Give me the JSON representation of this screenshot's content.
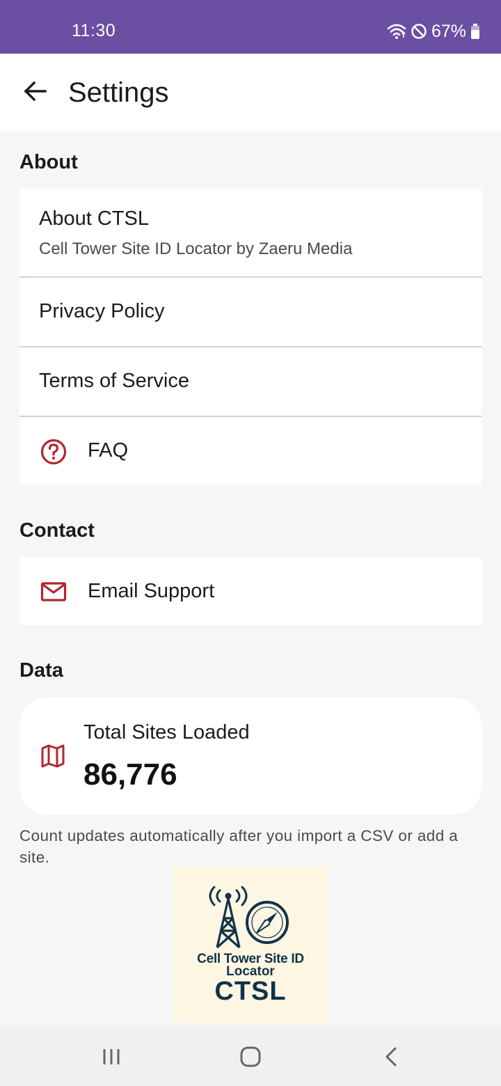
{
  "status_bar": {
    "time": "11:30",
    "battery": "67%",
    "icons": [
      "wifi-icon",
      "do-not-disturb-icon",
      "battery-icon"
    ]
  },
  "app_bar": {
    "title": "Settings",
    "back_icon": "arrow-left-icon"
  },
  "sections": {
    "about": {
      "title": "About",
      "about_ctsl": {
        "title": "About CTSL",
        "subtitle": "Cell Tower Site ID Locator by Zaeru Media"
      },
      "privacy_policy": "Privacy Policy",
      "terms_of_service": "Terms of Service",
      "faq": {
        "label": "FAQ",
        "icon": "help-circle-icon"
      }
    },
    "contact": {
      "title": "Contact",
      "email_support": {
        "label": "Email Support",
        "icon": "mail-icon"
      }
    },
    "data": {
      "title": "Data",
      "total_label": "Total Sites Loaded",
      "total_value": "86,776",
      "icon": "map-icon",
      "note": "Count updates automatically after you import a CSV or add a site."
    }
  },
  "logo": {
    "line1": "Cell Tower Site ID",
    "line2": "Locator",
    "line3": "CTSL"
  },
  "nav_bar": {
    "icons": [
      "recents-icon",
      "home-icon",
      "back-icon"
    ]
  },
  "colors": {
    "status_bar": "#6a4fa3",
    "accent_icon": "#b3262d",
    "logo_bg": "#fdf6e2",
    "logo_text": "#10334a"
  }
}
